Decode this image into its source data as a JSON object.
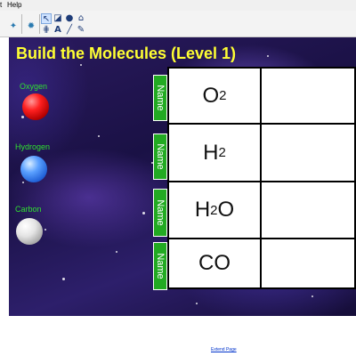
{
  "menu": {
    "left_fragment": "t",
    "help": "Help"
  },
  "title": "Build the Molecules (Level 1)",
  "atoms": [
    {
      "label": "Oxygen"
    },
    {
      "label": "Hydrogen"
    },
    {
      "label": "Carbon"
    }
  ],
  "name_button_label": "Name",
  "molecules": [
    {
      "base": "O",
      "sub": "2",
      "tail": ""
    },
    {
      "base": "H",
      "sub": "2",
      "tail": ""
    },
    {
      "base": "H",
      "sub": "2",
      "tail": "O"
    },
    {
      "base": "CO",
      "sub": "",
      "tail": ""
    }
  ],
  "footer": {
    "extend_link": "Extend Page"
  },
  "colors": {
    "title": "#ffff33",
    "atom_label": "#30e030",
    "name_button": "#22aa22"
  }
}
